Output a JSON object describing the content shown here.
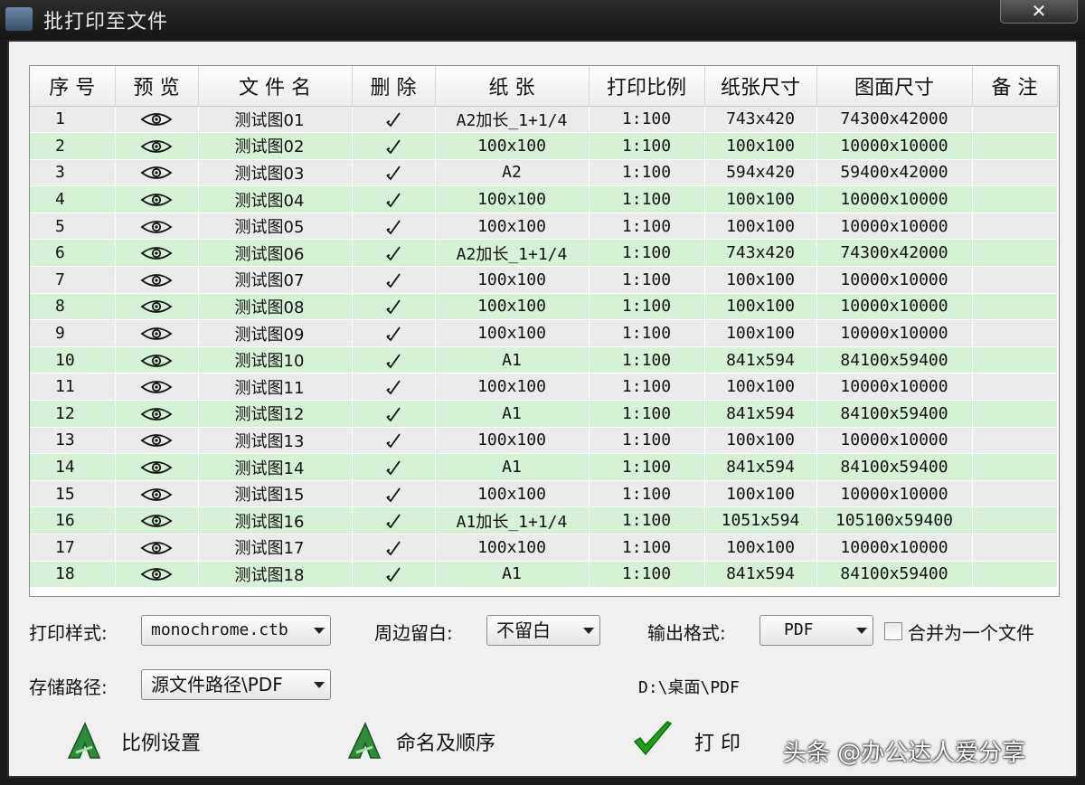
{
  "window": {
    "title": "批打印至文件",
    "close_glyph": "✕"
  },
  "table": {
    "headers": [
      "序 号",
      "预 览",
      "文 件 名",
      "删 除",
      "纸 张",
      "打印比例",
      "纸张尺寸",
      "图面尺寸",
      "备 注"
    ],
    "rows": [
      [
        "1",
        "测试图01",
        "A2加长_1+1/4",
        "1:100",
        "743x420",
        "74300x42000",
        ""
      ],
      [
        "2",
        "测试图02",
        "100x100",
        "1:100",
        "100x100",
        "10000x10000",
        ""
      ],
      [
        "3",
        "测试图03",
        "A2",
        "1:100",
        "594x420",
        "59400x42000",
        ""
      ],
      [
        "4",
        "测试图04",
        "100x100",
        "1:100",
        "100x100",
        "10000x10000",
        ""
      ],
      [
        "5",
        "测试图05",
        "100x100",
        "1:100",
        "100x100",
        "10000x10000",
        ""
      ],
      [
        "6",
        "测试图06",
        "A2加长_1+1/4",
        "1:100",
        "743x420",
        "74300x42000",
        ""
      ],
      [
        "7",
        "测试图07",
        "100x100",
        "1:100",
        "100x100",
        "10000x10000",
        ""
      ],
      [
        "8",
        "测试图08",
        "100x100",
        "1:100",
        "100x100",
        "10000x10000",
        ""
      ],
      [
        "9",
        "测试图09",
        "100x100",
        "1:100",
        "100x100",
        "10000x10000",
        ""
      ],
      [
        "10",
        "测试图10",
        "A1",
        "1:100",
        "841x594",
        "84100x59400",
        ""
      ],
      [
        "11",
        "测试图11",
        "100x100",
        "1:100",
        "100x100",
        "10000x10000",
        ""
      ],
      [
        "12",
        "测试图12",
        "A1",
        "1:100",
        "841x594",
        "84100x59400",
        ""
      ],
      [
        "13",
        "测试图13",
        "100x100",
        "1:100",
        "100x100",
        "10000x10000",
        ""
      ],
      [
        "14",
        "测试图14",
        "A1",
        "1:100",
        "841x594",
        "84100x59400",
        ""
      ],
      [
        "15",
        "测试图15",
        "100x100",
        "1:100",
        "100x100",
        "10000x10000",
        ""
      ],
      [
        "16",
        "测试图16",
        "A1加长_1+1/4",
        "1:100",
        "1051x594",
        "105100x59400",
        ""
      ],
      [
        "17",
        "测试图17",
        "100x100",
        "1:100",
        "100x100",
        "10000x10000",
        ""
      ],
      [
        "18",
        "测试图18",
        "A1",
        "1:100",
        "841x594",
        "84100x59400",
        ""
      ]
    ],
    "preview_icon": "eye-icon",
    "delete_icon": "check-icon",
    "row_colors": {
      "odd": "#ebebeb",
      "even": "#d6f2d6"
    }
  },
  "controls": {
    "print_style_label": "打印样式:",
    "print_style_value": "monochrome.ctb",
    "margin_label": "周边留白:",
    "margin_value": "不留白",
    "format_label": "输出格式:",
    "format_value": "PDF",
    "merge_label": "合并为一个文件",
    "merge_checked": false,
    "path_label": "存储路径:",
    "path_value": "源文件路径\\PDF",
    "path_display": "D:\\桌面\\PDF"
  },
  "actions": {
    "scale_label": "比例设置",
    "naming_label": "命名及顺序",
    "print_label": "打 印"
  },
  "watermark": "头条 @办公达人爱分享",
  "colors": {
    "accent_green": "#2e8b3a",
    "check_green": "#1aa31a"
  }
}
